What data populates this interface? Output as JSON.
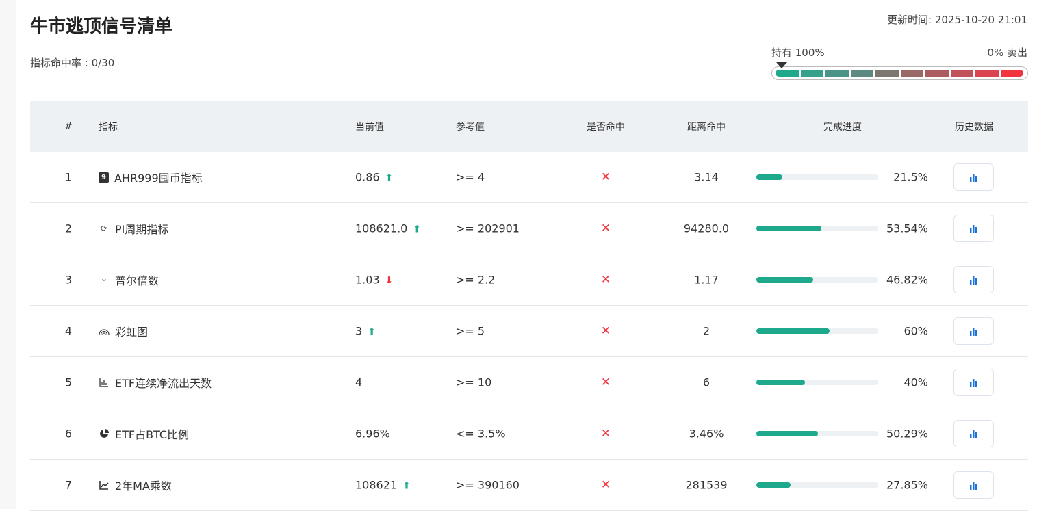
{
  "title": "牛市逃顶信号清单",
  "updated": "更新时间: 2025-10-20 21:01",
  "hit_rate": "指标命中率 : 0/30",
  "gauge": {
    "hold_label": "持有 100%",
    "sell_label": "0% 卖出",
    "position_percent": 100,
    "colors": [
      "#1fa98c",
      "#35a08b",
      "#4a9487",
      "#5d8a80",
      "#7c7671",
      "#996a68",
      "#ab5c5e",
      "#c2525a",
      "#d94450",
      "#f0333f"
    ]
  },
  "columns": [
    "#",
    "指标",
    "当前值",
    "参考值",
    "是否命中",
    "距离命中",
    "完成进度",
    "历史数据"
  ],
  "rows": [
    {
      "n": "1",
      "icon": "number-9-icon",
      "name": "AHR999囤币指标",
      "current": "0.86",
      "trend": "up",
      "ref": ">= 4",
      "hit": "✕",
      "distance": "3.14",
      "progress": 21.5,
      "pct": "21.5%"
    },
    {
      "n": "2",
      "icon": "cycle-icon",
      "name": "PI周期指标",
      "current": "108621.0",
      "trend": "up",
      "ref": ">= 202901",
      "hit": "✕",
      "distance": "94280.0",
      "progress": 53.54,
      "pct": "53.54%"
    },
    {
      "n": "3",
      "icon": "scatter-icon",
      "name": "普尔倍数",
      "current": "1.03",
      "trend": "down",
      "ref": ">= 2.2",
      "hit": "✕",
      "distance": "1.17",
      "progress": 46.82,
      "pct": "46.82%"
    },
    {
      "n": "4",
      "icon": "rainbow-icon",
      "name": "彩虹图",
      "current": "3",
      "trend": "up",
      "ref": ">= 5",
      "hit": "✕",
      "distance": "2",
      "progress": 60,
      "pct": "60%"
    },
    {
      "n": "5",
      "icon": "bar-chart-icon",
      "name": "ETF连续净流出天数",
      "current": "4",
      "trend": "",
      "ref": ">= 10",
      "hit": "✕",
      "distance": "6",
      "progress": 40,
      "pct": "40%"
    },
    {
      "n": "6",
      "icon": "pie-chart-icon",
      "name": "ETF占BTC比例",
      "current": "6.96%",
      "trend": "",
      "ref": "<= 3.5%",
      "hit": "✕",
      "distance": "3.46%",
      "progress": 50.29,
      "pct": "50.29%"
    },
    {
      "n": "7",
      "icon": "line-chart-icon",
      "name": "2年MA乘数",
      "current": "108621",
      "trend": "up",
      "ref": ">= 390160",
      "hit": "✕",
      "distance": "281539",
      "progress": 27.85,
      "pct": "27.85%"
    }
  ]
}
